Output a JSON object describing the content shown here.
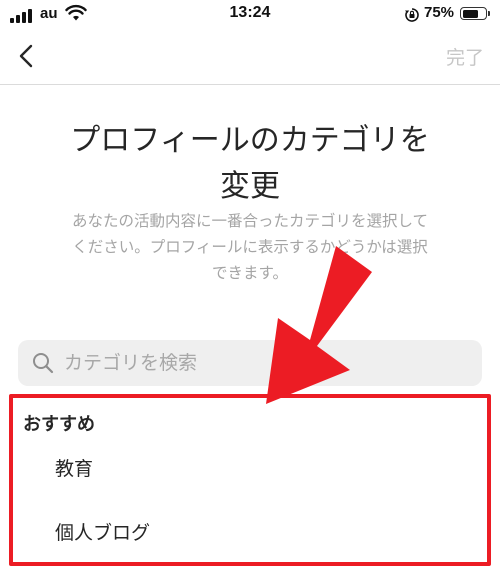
{
  "status_bar": {
    "carrier": "au",
    "time": "13:24",
    "battery_percent": "75%",
    "battery_level": 0.75,
    "icons": [
      "signal-icon",
      "wifi-icon",
      "orientation-lock-icon",
      "battery-icon"
    ]
  },
  "nav": {
    "back_icon": "chevron-left-icon",
    "done_label": "完了"
  },
  "page": {
    "title_line1": "プロフィールのカテゴリを",
    "title_line2": "変更",
    "description_line1": "あなたの活動内容に一番合ったカテゴリを選択して",
    "description_line2": "ください。プロフィールに表示するかどうかは選択",
    "description_line3": "できます。"
  },
  "search": {
    "placeholder": "カテゴリを検索",
    "value": "",
    "icon": "search-icon"
  },
  "suggestions": {
    "header": "おすすめ",
    "items": [
      {
        "label": "教育"
      },
      {
        "label": "個人ブログ"
      }
    ]
  },
  "annotation": {
    "color": "#ec1c24"
  },
  "colors": {
    "text": "#262626",
    "muted": "#a5a5a5",
    "disabled": "#c6c6c6",
    "search_bg": "#efefef"
  }
}
